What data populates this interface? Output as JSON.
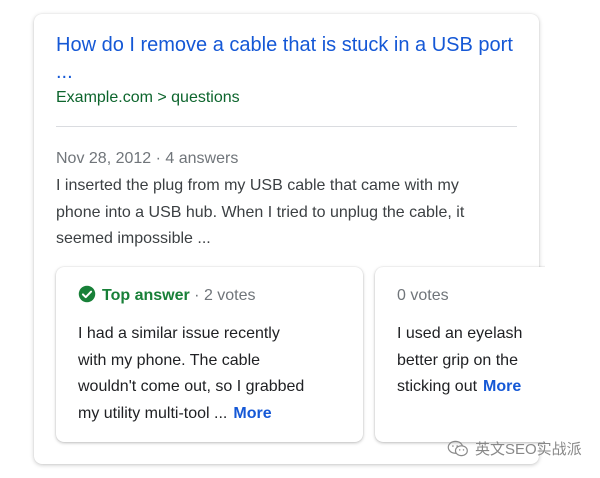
{
  "result": {
    "title": "How do I remove a cable that is stuck in a USB port ...",
    "breadcrumb": "Example.com > questions",
    "meta": "Nov 28, 2012 · 4 answers",
    "snippet": "I inserted the plug from my USB cable that came with my phone into a USB hub. When I tried to unplug the cable, it seemed impossible ..."
  },
  "answers": [
    {
      "top_label": "Top answer",
      "votes": " · 2 votes",
      "lines": [
        "I had a similar issue recently",
        "with my phone. The cable",
        "wouldn't come out, so I grabbed",
        "my utility multi-tool ..."
      ],
      "more": "More",
      "icon": "check-circle-icon"
    },
    {
      "votes": "0 votes",
      "lines": [
        "I used an eyelash",
        "better grip on the",
        "sticking out"
      ],
      "more": "More"
    }
  ],
  "watermark": {
    "text": "英文SEO实战派",
    "icon": "wechat-icon"
  },
  "colors": {
    "link": "#1558d6",
    "breadcrumb": "#0d652d",
    "top_answer": "#188038",
    "muted": "#70757a"
  }
}
